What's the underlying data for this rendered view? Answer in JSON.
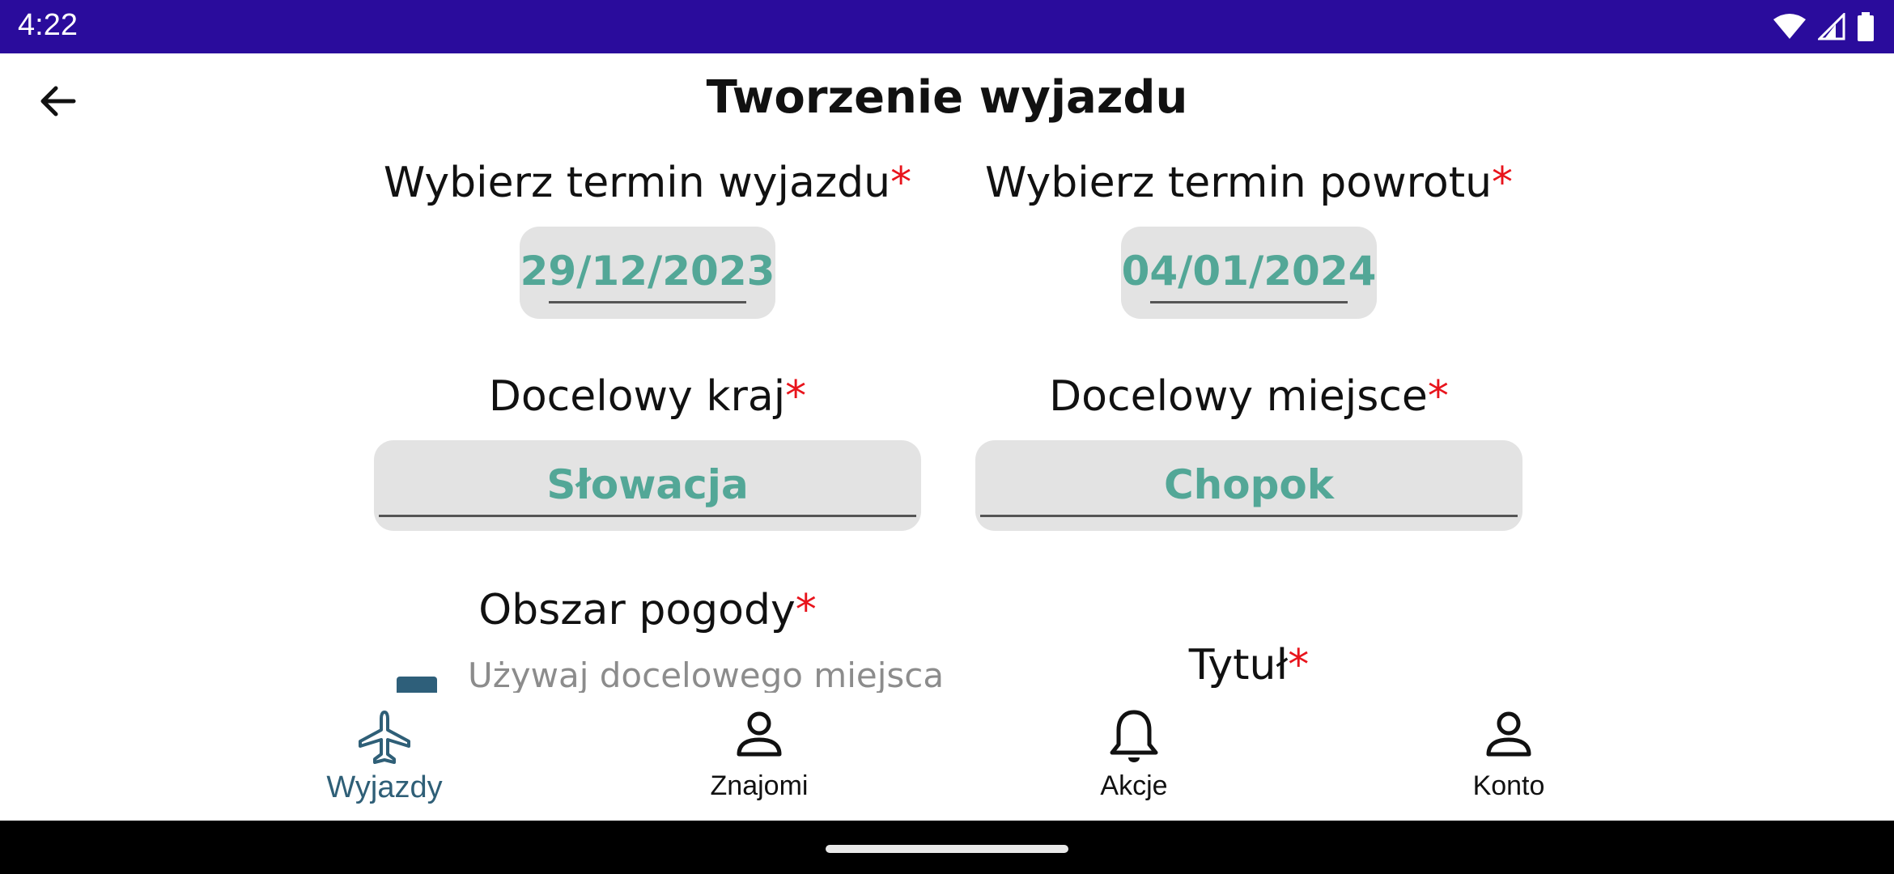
{
  "status_bar": {
    "time": "4:22",
    "icons": [
      "wifi-icon",
      "signal-icon",
      "battery-icon"
    ]
  },
  "header": {
    "title": "Tworzenie wyjazdu",
    "back_icon": "arrow-back-icon"
  },
  "form": {
    "required_mark": "*",
    "departure": {
      "label": "Wybierz termin wyjazdu",
      "value": "29/12/2023"
    },
    "return": {
      "label": "Wybierz termin powrotu",
      "value": "04/01/2024"
    },
    "country": {
      "label": "Docelowy kraj",
      "value": "Słowacja"
    },
    "place": {
      "label": "Docelowy miejsce",
      "value": "Chopok"
    },
    "weather_area": {
      "label": "Obszar pogody",
      "checkbox_label": "Używaj docelowego miejsca"
    },
    "title": {
      "label": "Tytuł"
    }
  },
  "bottom_nav": {
    "items": [
      {
        "label": "Wyjazdy",
        "icon": "airplane-icon",
        "active": true
      },
      {
        "label": "Znajomi",
        "icon": "person-icon",
        "active": false
      },
      {
        "label": "Akcje",
        "icon": "bell-icon",
        "active": false
      },
      {
        "label": "Konto",
        "icon": "person-icon",
        "active": false
      }
    ]
  },
  "colors": {
    "status_bar": "#2a0c9c",
    "accent_value": "#53a797",
    "required": "#e8141c",
    "active_nav": "#2f5f77",
    "input_bg": "#e3e3e3"
  }
}
